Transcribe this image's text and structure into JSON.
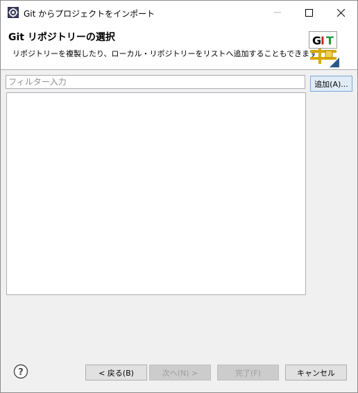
{
  "window": {
    "title": "Git からプロジェクトをインポート",
    "minimize_icon": "minimize-icon",
    "maximize_icon": "maximize-icon",
    "close_icon": "close-icon"
  },
  "banner": {
    "title": "Git リポジトリーの選択",
    "description": "リポジトリーを複製したり、ローカル・リポジトリーをリストへ追加することもできます",
    "logo_text": "GIT",
    "logo_colors": {
      "G": "#000000",
      "I": "#cc2222",
      "T": "#1a9a3a"
    }
  },
  "filter": {
    "placeholder": "フィルター入力",
    "value": ""
  },
  "buttons": {
    "add": "追加(A)...",
    "back": "< 戻る(B)",
    "next": "次へ(N) >",
    "finish": "完了(F)",
    "cancel": "キャンセル"
  },
  "repositories": [],
  "colors": {
    "content_bg": "#f0f0f0",
    "accent_border": "#7aa7d6",
    "accent_bg": "#e1ecf7"
  }
}
